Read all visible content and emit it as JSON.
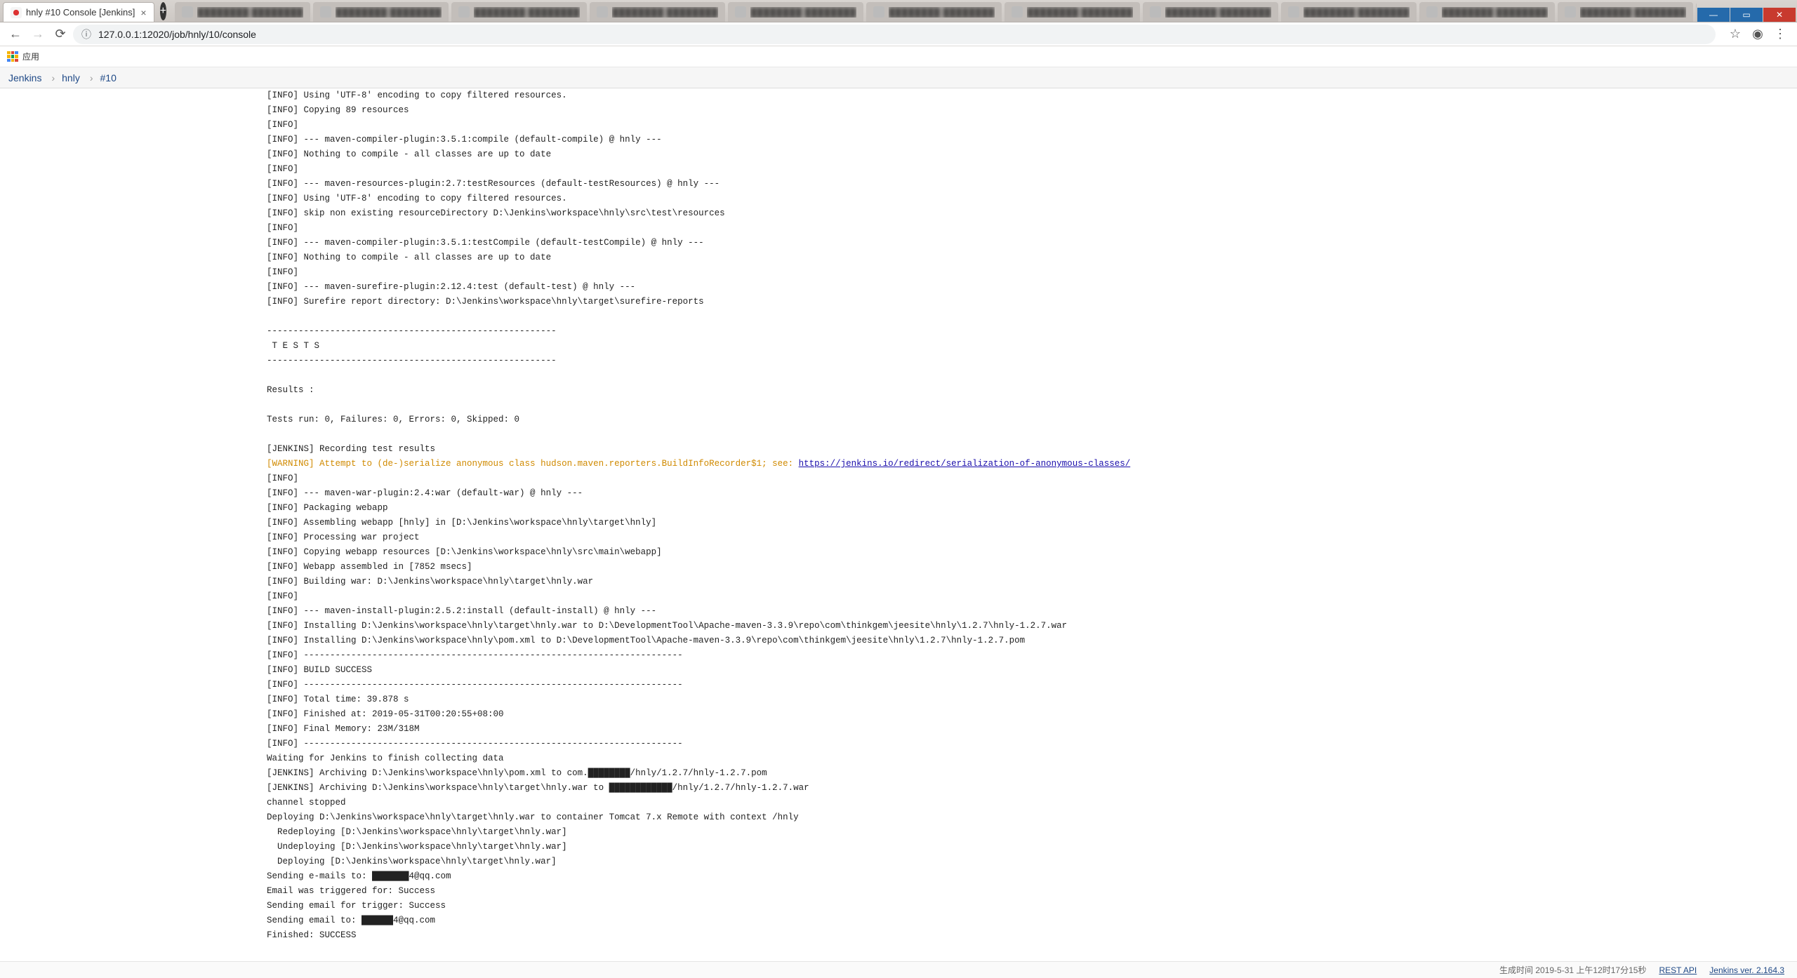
{
  "window": {
    "active_tab_title": "hnly #10 Console [Jenkins]",
    "url": "127.0.0.1:12020/job/hnly/10/console",
    "bookmarks_app_label": "应用"
  },
  "breadcrumb": {
    "root": "Jenkins",
    "job": "hnly",
    "build": "#10"
  },
  "console": {
    "lines": [
      {
        "t": "[INFO] Using 'UTF-8' encoding to copy filtered resources."
      },
      {
        "t": "[INFO] Copying 89 resources"
      },
      {
        "t": "[INFO]"
      },
      {
        "t": "[INFO] --- maven-compiler-plugin:3.5.1:compile (default-compile) @ hnly ---"
      },
      {
        "t": "[INFO] Nothing to compile - all classes are up to date"
      },
      {
        "t": "[INFO]"
      },
      {
        "t": "[INFO] --- maven-resources-plugin:2.7:testResources (default-testResources) @ hnly ---"
      },
      {
        "t": "[INFO] Using 'UTF-8' encoding to copy filtered resources."
      },
      {
        "t": "[INFO] skip non existing resourceDirectory D:\\Jenkins\\workspace\\hnly\\src\\test\\resources"
      },
      {
        "t": "[INFO]"
      },
      {
        "t": "[INFO] --- maven-compiler-plugin:3.5.1:testCompile (default-testCompile) @ hnly ---"
      },
      {
        "t": "[INFO] Nothing to compile - all classes are up to date"
      },
      {
        "t": "[INFO]"
      },
      {
        "t": "[INFO] --- maven-surefire-plugin:2.12.4:test (default-test) @ hnly ---"
      },
      {
        "t": "[INFO] Surefire report directory: D:\\Jenkins\\workspace\\hnly\\target\\surefire-reports"
      },
      {
        "t": ""
      },
      {
        "t": "-------------------------------------------------------"
      },
      {
        "t": " T E S T S"
      },
      {
        "t": "-------------------------------------------------------"
      },
      {
        "t": ""
      },
      {
        "t": "Results :"
      },
      {
        "t": ""
      },
      {
        "t": "Tests run: 0, Failures: 0, Errors: 0, Skipped: 0"
      },
      {
        "t": ""
      },
      {
        "t": "[JENKINS] Recording test results"
      },
      {
        "warn": true,
        "prefix": "[WARNING] Attempt to (de-)serialize anonymous class hudson.maven.reporters.BuildInfoRecorder$1; see: ",
        "link": "https://jenkins.io/redirect/serialization-of-anonymous-classes/"
      },
      {
        "t": "[INFO]"
      },
      {
        "t": "[INFO] --- maven-war-plugin:2.4:war (default-war) @ hnly ---"
      },
      {
        "t": "[INFO] Packaging webapp"
      },
      {
        "t": "[INFO] Assembling webapp [hnly] in [D:\\Jenkins\\workspace\\hnly\\target\\hnly]"
      },
      {
        "t": "[INFO] Processing war project"
      },
      {
        "t": "[INFO] Copying webapp resources [D:\\Jenkins\\workspace\\hnly\\src\\main\\webapp]"
      },
      {
        "t": "[INFO] Webapp assembled in [7852 msecs]"
      },
      {
        "t": "[INFO] Building war: D:\\Jenkins\\workspace\\hnly\\target\\hnly.war"
      },
      {
        "t": "[INFO]"
      },
      {
        "t": "[INFO] --- maven-install-plugin:2.5.2:install (default-install) @ hnly ---"
      },
      {
        "t": "[INFO] Installing D:\\Jenkins\\workspace\\hnly\\target\\hnly.war to D:\\DevelopmentTool\\Apache-maven-3.3.9\\repo\\com\\thinkgem\\jeesite\\hnly\\1.2.7\\hnly-1.2.7.war"
      },
      {
        "t": "[INFO] Installing D:\\Jenkins\\workspace\\hnly\\pom.xml to D:\\DevelopmentTool\\Apache-maven-3.3.9\\repo\\com\\thinkgem\\jeesite\\hnly\\1.2.7\\hnly-1.2.7.pom"
      },
      {
        "t": "[INFO] ------------------------------------------------------------------------"
      },
      {
        "t": "[INFO] BUILD SUCCESS"
      },
      {
        "t": "[INFO] ------------------------------------------------------------------------"
      },
      {
        "t": "[INFO] Total time: 39.878 s"
      },
      {
        "t": "[INFO] Finished at: 2019-05-31T00:20:55+08:00"
      },
      {
        "t": "[INFO] Final Memory: 23M/318M"
      },
      {
        "t": "[INFO] ------------------------------------------------------------------------"
      },
      {
        "t": "Waiting for Jenkins to finish collecting data"
      },
      {
        "t": "[JENKINS] Archiving D:\\Jenkins\\workspace\\hnly\\pom.xml to com.████████/hnly/1.2.7/hnly-1.2.7.pom"
      },
      {
        "t": "[JENKINS] Archiving D:\\Jenkins\\workspace\\hnly\\target\\hnly.war to ████████████/hnly/1.2.7/hnly-1.2.7.war"
      },
      {
        "t": "channel stopped"
      },
      {
        "t": "Deploying D:\\Jenkins\\workspace\\hnly\\target\\hnly.war to container Tomcat 7.x Remote with context /hnly"
      },
      {
        "t": "  Redeploying [D:\\Jenkins\\workspace\\hnly\\target\\hnly.war]"
      },
      {
        "t": "  Undeploying [D:\\Jenkins\\workspace\\hnly\\target\\hnly.war]"
      },
      {
        "t": "  Deploying [D:\\Jenkins\\workspace\\hnly\\target\\hnly.war]"
      },
      {
        "t": "Sending e-mails to: ███████4@qq.com"
      },
      {
        "t": "Email was triggered for: Success"
      },
      {
        "t": "Sending email for trigger: Success"
      },
      {
        "t": "Sending email to: ██████4@qq.com"
      },
      {
        "t": "Finished: SUCCESS"
      }
    ]
  },
  "footer": {
    "generated": "生成时间 2019-5-31 上午12时17分15秒",
    "rest_api": "REST API",
    "version": "Jenkins ver. 2.164.3"
  }
}
